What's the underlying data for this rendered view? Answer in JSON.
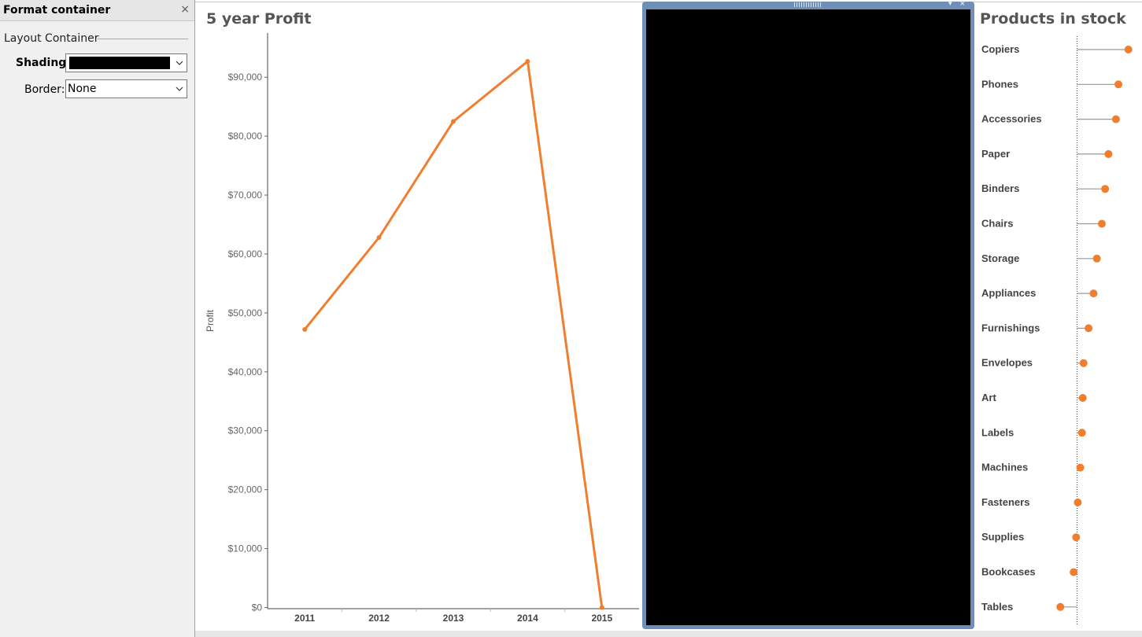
{
  "format_panel": {
    "title": "Format container",
    "close_glyph": "×",
    "section": "Layout Container",
    "shading_label": "Shading:",
    "shading_color": "#000000",
    "border_label": "Border:",
    "border_value": "None"
  },
  "container": {
    "background": "#000000",
    "frame_color": "#6f8fb8",
    "menu_glyph": "▾",
    "close_glyph": "×"
  },
  "accent_color": "#f07e2f",
  "chart_data": [
    {
      "type": "line",
      "title": "5 year Profit",
      "xlabel": "",
      "ylabel": "Profit",
      "categories": [
        "2011",
        "2012",
        "2013",
        "2014",
        "2015"
      ],
      "values": [
        47200,
        62800,
        82500,
        92700,
        0
      ],
      "ylim": [
        -200,
        97500
      ],
      "yticks": [
        0,
        10000,
        20000,
        30000,
        40000,
        50000,
        60000,
        70000,
        80000,
        90000
      ],
      "ytick_labels": [
        "$0",
        "$10,000",
        "$20,000",
        "$30,000",
        "$40,000",
        "$50,000",
        "$60,000",
        "$70,000",
        "$80,000",
        "$90,000"
      ],
      "grid": false,
      "color": "#f07e2f"
    },
    {
      "type": "scatter",
      "title": "Products in stock",
      "categories": [
        "Copiers",
        "Phones",
        "Accessories",
        "Paper",
        "Binders",
        "Chairs",
        "Storage",
        "Appliances",
        "Furnishings",
        "Envelopes",
        "Art",
        "Labels",
        "Machines",
        "Fasteners",
        "Supplies",
        "Bookcases",
        "Tables"
      ],
      "values": [
        62,
        50,
        47,
        38,
        34,
        30,
        24,
        20,
        14,
        8,
        7,
        6,
        4,
        1,
        -1,
        -4,
        -20
      ],
      "baseline": 0,
      "xlim": [
        -25,
        68
      ],
      "grid": false,
      "color": "#f07e2f"
    }
  ]
}
